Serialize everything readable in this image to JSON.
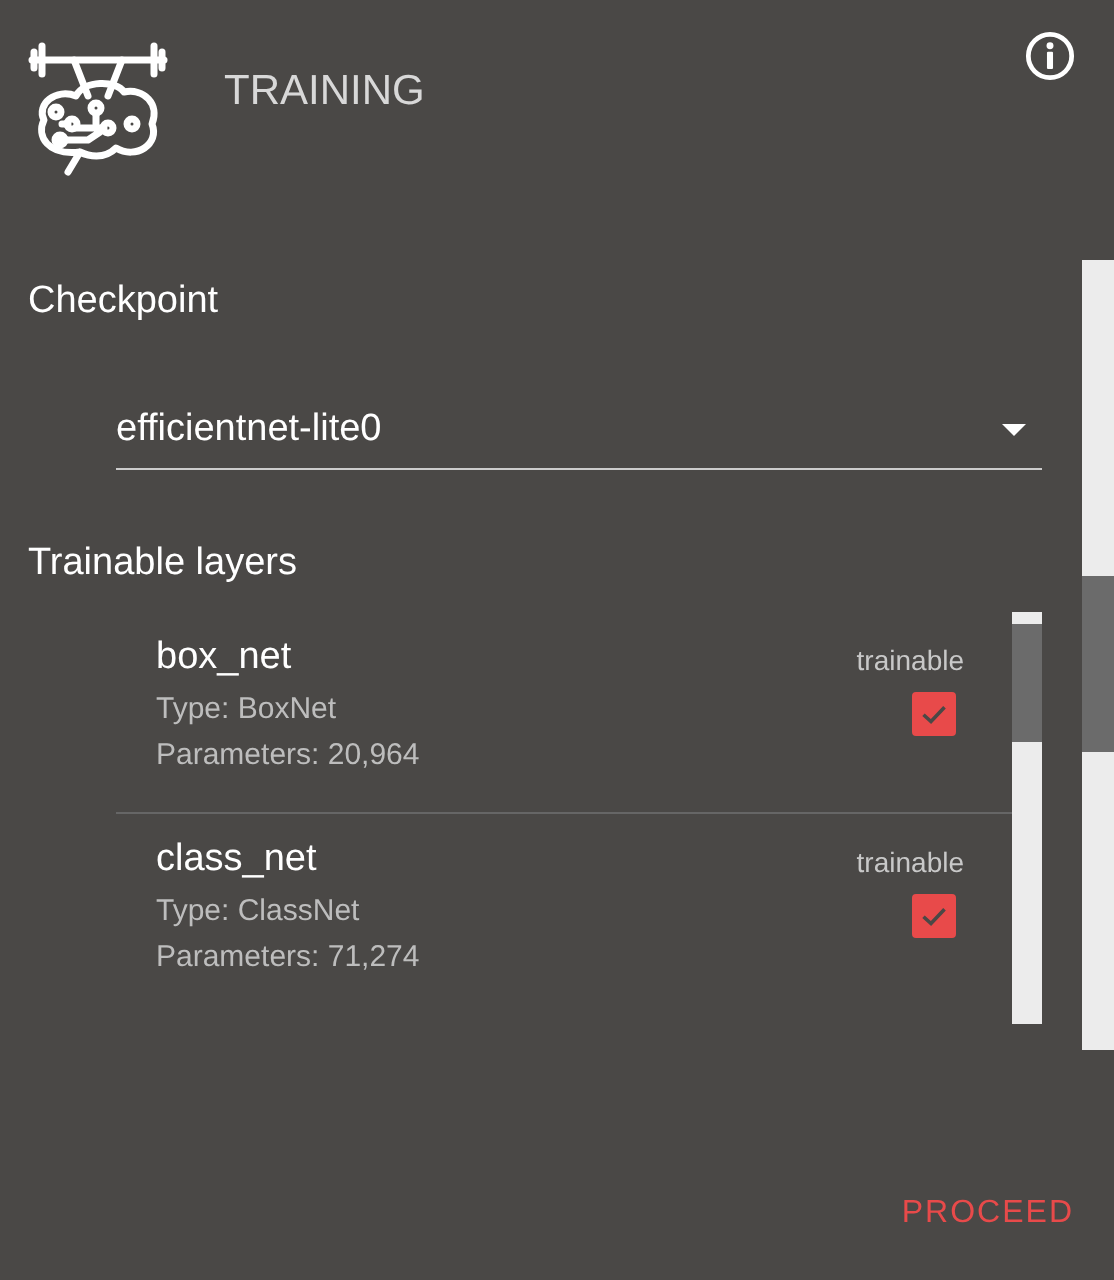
{
  "header": {
    "title": "TRAINING"
  },
  "checkpoint": {
    "label": "Checkpoint",
    "value": "efficientnet-lite0"
  },
  "layers": {
    "label": "Trainable layers",
    "items": [
      {
        "name": "box_net",
        "type": "Type: BoxNet",
        "parameters": "Parameters: 20,964",
        "trainable_label": "trainable",
        "checked": true
      },
      {
        "name": "class_net",
        "type": "Type: ClassNet",
        "parameters": "Parameters: 71,274",
        "trainable_label": "trainable",
        "checked": true
      }
    ]
  },
  "proceed": "PROCEED"
}
